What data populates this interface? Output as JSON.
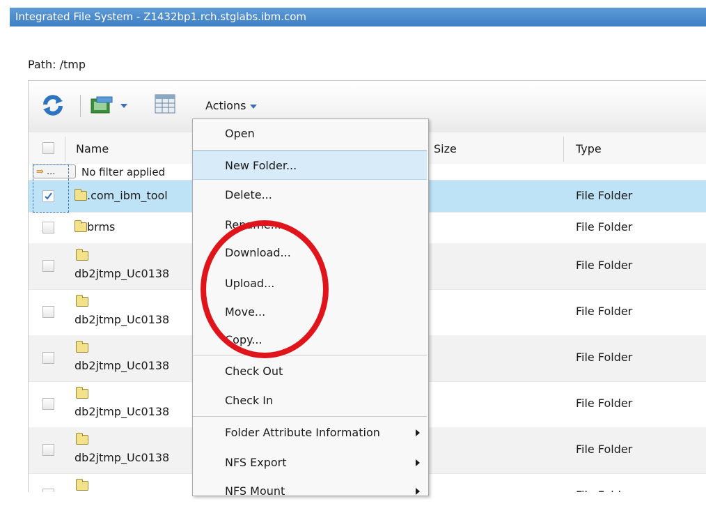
{
  "window": {
    "title": "Integrated File System - Z1432bp1.rch.stglabs.ibm.com"
  },
  "path": {
    "label": "Path: /tmp"
  },
  "toolbar": {
    "icons": [
      "refresh-icon",
      "transfer-icon",
      "dropdown-arrow-icon",
      "table-properties-icon"
    ],
    "actions_label": "Actions"
  },
  "table": {
    "columns": {
      "name": "Name",
      "size": "Size",
      "type": "Type"
    },
    "filter": {
      "button": "...",
      "text": "No filter applied"
    },
    "rows": [
      {
        "name": ".com_ibm_tool",
        "type": "File Folder",
        "selected": true
      },
      {
        "name": "brms",
        "type": "File Folder"
      },
      {
        "name": "db2jtmp_Uc0138",
        "type": "File Folder"
      },
      {
        "name": "db2jtmp_Uc0138",
        "type": "File Folder"
      },
      {
        "name": "db2jtmp_Uc0138",
        "type": "File Folder"
      },
      {
        "name": "db2jtmp_Uc0138",
        "type": "File Folder"
      },
      {
        "name": "db2jtmp_Uc0138",
        "type": "File Folder"
      },
      {
        "name": "",
        "type": "File Folder"
      }
    ]
  },
  "menu": {
    "items": [
      {
        "label": "Open"
      },
      {
        "label": "New Folder..."
      },
      {
        "label": "Delete..."
      },
      {
        "label": "Rename..."
      },
      {
        "label": "Download..."
      },
      {
        "label": "Upload..."
      },
      {
        "label": "Move..."
      },
      {
        "label": "Copy..."
      },
      {
        "label": "Check Out"
      },
      {
        "label": "Check In"
      },
      {
        "label": "Folder Attribute Information"
      },
      {
        "label": "NFS Export"
      },
      {
        "label": "NFS Mount"
      }
    ]
  },
  "colors": {
    "titlebar": "#4a8bcd",
    "selected_row": "#bfe3f6",
    "annotation_circle": "#e0151c",
    "menu_hover": "#d7ebf8"
  }
}
